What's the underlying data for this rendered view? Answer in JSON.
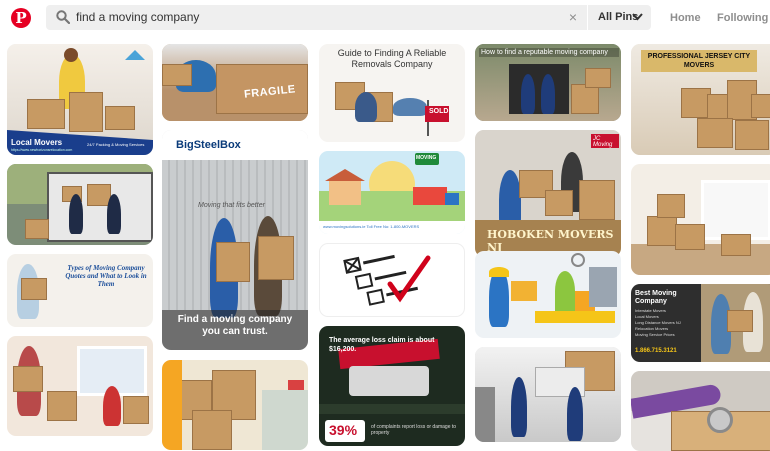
{
  "header": {
    "logo_letter": "P",
    "search_query": "find a moving company",
    "clear_glyph": "×",
    "scope_label": "All Pins",
    "nav": [
      "Home",
      "Following"
    ]
  },
  "pins": {
    "local_movers": {
      "title": "Local Movers",
      "sub": "24/7 Packing & Moving Services",
      "url": "https://www.newhorizonsrelocation.com"
    },
    "big_steel_box": {
      "brand": "BigSteelBox",
      "side": "Moving that fits better",
      "caption": "Find a moving company you can trust."
    },
    "types_moving": {
      "title": "Types of Moving Company Quotes and What to Look in Them"
    },
    "fragile": {
      "label": "FRAGILE"
    },
    "guide": {
      "title": "Guide to Finding A Reliable Removals Company",
      "sign": "SOLD"
    },
    "illustration": {
      "badge": "MOVING",
      "footer": "www.movingsolutions.ie   Toll Free No: 1-800-MOVERS"
    },
    "average_loss": {
      "title": "The average loss claim is about $16,200.",
      "stat": "39%",
      "fine": "of complaints report loss or damage to property"
    },
    "reputable": {
      "title": "How to find a reputable moving company"
    },
    "hoboken": {
      "title": "HOBOKEN MOVERS NJ",
      "tag": "JC Moving"
    },
    "jersey": {
      "title": "PROFESSIONAL JERSEY CITY MOVERS"
    },
    "best_moving": {
      "title": "Best Moving Company",
      "items": [
        "Interstate Movers",
        "Local Movers",
        "Long Distance Movers NJ",
        "Relocation Movers",
        "Moving Service Prices"
      ],
      "phone": "1.866.715.3121"
    }
  },
  "colors": {
    "brand_red": "#e60023",
    "search_bg": "#efefef",
    "text": "#333333",
    "muted": "#8e8e8e"
  }
}
